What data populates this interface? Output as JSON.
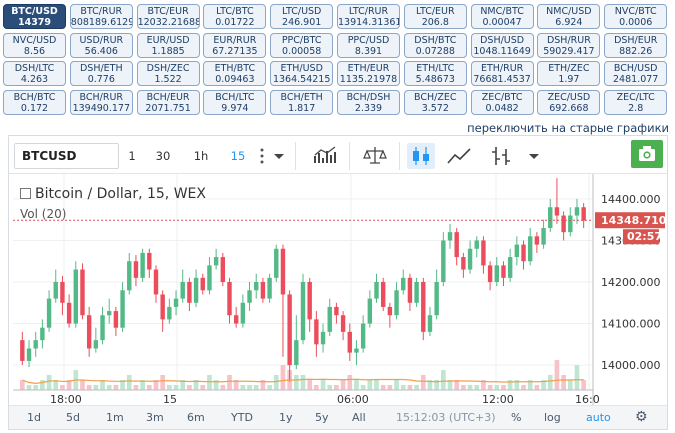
{
  "tickers": [
    {
      "pair": "BTC/USD",
      "price": "14379",
      "active": true
    },
    {
      "pair": "BTC/RUR",
      "price": "808189.6129"
    },
    {
      "pair": "BTC/EUR",
      "price": "12032.21688"
    },
    {
      "pair": "LTC/BTC",
      "price": "0.01722"
    },
    {
      "pair": "LTC/USD",
      "price": "246.901"
    },
    {
      "pair": "LTC/RUR",
      "price": "13914.31361"
    },
    {
      "pair": "LTC/EUR",
      "price": "206.8"
    },
    {
      "pair": "NMC/BTC",
      "price": "0.00047"
    },
    {
      "pair": "NMC/USD",
      "price": "6.924"
    },
    {
      "pair": "NVC/BTC",
      "price": "0.0006"
    },
    {
      "pair": "NVC/USD",
      "price": "8.56"
    },
    {
      "pair": "USD/RUR",
      "price": "56.406"
    },
    {
      "pair": "EUR/USD",
      "price": "1.1885"
    },
    {
      "pair": "EUR/RUR",
      "price": "67.27135"
    },
    {
      "pair": "PPC/BTC",
      "price": "0.00058"
    },
    {
      "pair": "PPC/USD",
      "price": "8.391"
    },
    {
      "pair": "DSH/BTC",
      "price": "0.07288"
    },
    {
      "pair": "DSH/USD",
      "price": "1048.11649"
    },
    {
      "pair": "DSH/RUR",
      "price": "59029.417"
    },
    {
      "pair": "DSH/EUR",
      "price": "882.26"
    },
    {
      "pair": "DSH/LTC",
      "price": "4.263"
    },
    {
      "pair": "DSH/ETH",
      "price": "0.776"
    },
    {
      "pair": "DSH/ZEC",
      "price": "1.522"
    },
    {
      "pair": "ETH/BTC",
      "price": "0.09463"
    },
    {
      "pair": "ETH/USD",
      "price": "1364.54215"
    },
    {
      "pair": "ETH/EUR",
      "price": "1135.21978"
    },
    {
      "pair": "ETH/LTC",
      "price": "5.48673"
    },
    {
      "pair": "ETH/RUR",
      "price": "76681.4537"
    },
    {
      "pair": "ETH/ZEC",
      "price": "1.97"
    },
    {
      "pair": "BCH/USD",
      "price": "2481.077"
    },
    {
      "pair": "BCH/BTC",
      "price": "0.172"
    },
    {
      "pair": "BCH/RUR",
      "price": "139490.177"
    },
    {
      "pair": "BCH/EUR",
      "price": "2071.751"
    },
    {
      "pair": "BCH/LTC",
      "price": "9.974"
    },
    {
      "pair": "BCH/ETH",
      "price": "1.817"
    },
    {
      "pair": "BCH/DSH",
      "price": "2.339"
    },
    {
      "pair": "BCH/ZEC",
      "price": "3.572"
    },
    {
      "pair": "ZEC/BTC",
      "price": "0.0482"
    },
    {
      "pair": "ZEC/USD",
      "price": "692.668"
    },
    {
      "pair": "ZEC/LTC",
      "price": "2.8"
    }
  ],
  "switch_link": "переключить на старые графики",
  "toolbar": {
    "symbol": "BTCUSD",
    "intervals": [
      "1",
      "30",
      "1h",
      "15"
    ],
    "active_interval": "15",
    "icons": [
      "bars-icon",
      "indicators-icon",
      "candles-icon",
      "area-icon",
      "bar-style-icon"
    ],
    "camera_icon": "camera-icon"
  },
  "legend": {
    "title": "Bitcoin / Dollar, 15, WEX",
    "volume": "Vol (20)"
  },
  "price_axis": {
    "ticks": [
      "14400.000",
      "14300.000",
      "14200.000",
      "14100.000",
      "14000.000"
    ],
    "last_price": "14348.710",
    "countdown": "02:57"
  },
  "time_axis": {
    "ticks": [
      "18:00",
      "15",
      "06:00",
      "12:00",
      "16:0"
    ]
  },
  "bottombar": {
    "ranges": [
      "1d",
      "5d",
      "1m",
      "3m",
      "6m",
      "YTD",
      "1y",
      "5y",
      "All"
    ],
    "clock": "15:12:03 (UTC+3)",
    "percent": "%",
    "log": "log",
    "auto": "auto"
  },
  "chart_data": {
    "type": "candlestick",
    "title": "Bitcoin / Dollar, 15, WEX",
    "ylim": [
      13940,
      14460
    ],
    "up_color": "#53b987",
    "down_color": "#eb4d5c",
    "candles": [
      [
        14060,
        14010,
        14080,
        14000
      ],
      [
        14010,
        14040,
        14060,
        13995
      ],
      [
        14040,
        14060,
        14080,
        14020
      ],
      [
        14060,
        14090,
        14110,
        14040
      ],
      [
        14090,
        14160,
        14180,
        14080
      ],
      [
        14160,
        14200,
        14230,
        14150
      ],
      [
        14200,
        14150,
        14215,
        14120
      ],
      [
        14150,
        14100,
        14170,
        14090
      ],
      [
        14100,
        14230,
        14250,
        14090
      ],
      [
        14230,
        14120,
        14245,
        14110
      ],
      [
        14120,
        14040,
        14140,
        14020
      ],
      [
        14040,
        14060,
        14090,
        14030
      ],
      [
        14060,
        14120,
        14140,
        14050
      ],
      [
        14120,
        14130,
        14160,
        14100
      ],
      [
        14130,
        14090,
        14140,
        14070
      ],
      [
        14090,
        14180,
        14200,
        14080
      ],
      [
        14180,
        14250,
        14270,
        14170
      ],
      [
        14250,
        14210,
        14265,
        14190
      ],
      [
        14210,
        14270,
        14280,
        14200
      ],
      [
        14270,
        14230,
        14280,
        14210
      ],
      [
        14230,
        14170,
        14240,
        14150
      ],
      [
        14170,
        14110,
        14180,
        14080
      ],
      [
        14110,
        14140,
        14160,
        14100
      ],
      [
        14140,
        14160,
        14180,
        14120
      ],
      [
        14160,
        14200,
        14230,
        14150
      ],
      [
        14200,
        14150,
        14210,
        14130
      ],
      [
        14150,
        14210,
        14230,
        14140
      ],
      [
        14210,
        14180,
        14220,
        14170
      ],
      [
        14180,
        14240,
        14260,
        14170
      ],
      [
        14240,
        14260,
        14280,
        14230
      ],
      [
        14260,
        14200,
        14270,
        14190
      ],
      [
        14200,
        14120,
        14210,
        14100
      ],
      [
        14120,
        14100,
        14140,
        14090
      ],
      [
        14100,
        14150,
        14170,
        14090
      ],
      [
        14150,
        14180,
        14200,
        14130
      ],
      [
        14180,
        14200,
        14220,
        14160
      ],
      [
        14200,
        14160,
        14210,
        14150
      ],
      [
        14160,
        14210,
        14220,
        14150
      ],
      [
        14210,
        14280,
        14290,
        14200
      ],
      [
        14280,
        14170,
        14290,
        14020
      ],
      [
        14170,
        14000,
        14180,
        13960
      ],
      [
        14000,
        14060,
        14120,
        13990
      ],
      [
        14060,
        14200,
        14220,
        14050
      ],
      [
        14200,
        14110,
        14210,
        14080
      ],
      [
        14110,
        14050,
        14130,
        14020
      ],
      [
        14050,
        14080,
        14100,
        14030
      ],
      [
        14080,
        14140,
        14160,
        14070
      ],
      [
        14140,
        14120,
        14150,
        14100
      ],
      [
        14120,
        14080,
        14130,
        14060
      ],
      [
        14080,
        14030,
        14100,
        14010
      ],
      [
        14030,
        14040,
        14060,
        14000
      ],
      [
        14040,
        14100,
        14120,
        14030
      ],
      [
        14100,
        14160,
        14180,
        14090
      ],
      [
        14160,
        14200,
        14220,
        14150
      ],
      [
        14200,
        14140,
        14210,
        14130
      ],
      [
        14140,
        14120,
        14150,
        14090
      ],
      [
        14120,
        14180,
        14200,
        14110
      ],
      [
        14180,
        14210,
        14230,
        14170
      ],
      [
        14210,
        14150,
        14220,
        14130
      ],
      [
        14150,
        14200,
        14210,
        14140
      ],
      [
        14200,
        14080,
        14210,
        14060
      ],
      [
        14080,
        14120,
        14140,
        14070
      ],
      [
        14120,
        14200,
        14230,
        14110
      ],
      [
        14200,
        14300,
        14320,
        14190
      ],
      [
        14300,
        14320,
        14340,
        14280
      ],
      [
        14320,
        14260,
        14330,
        14240
      ],
      [
        14260,
        14230,
        14270,
        14210
      ],
      [
        14230,
        14280,
        14300,
        14220
      ],
      [
        14280,
        14300,
        14310,
        14260
      ],
      [
        14300,
        14240,
        14310,
        14220
      ],
      [
        14240,
        14200,
        14250,
        14180
      ],
      [
        14200,
        14240,
        14260,
        14190
      ],
      [
        14240,
        14210,
        14250,
        14190
      ],
      [
        14210,
        14260,
        14280,
        14200
      ],
      [
        14260,
        14290,
        14310,
        14240
      ],
      [
        14290,
        14250,
        14300,
        14230
      ],
      [
        14250,
        14310,
        14330,
        14240
      ],
      [
        14310,
        14290,
        14320,
        14270
      ],
      [
        14290,
        14330,
        14350,
        14280
      ],
      [
        14330,
        14380,
        14400,
        14320
      ],
      [
        14380,
        14360,
        14450,
        14340
      ],
      [
        14360,
        14320,
        14370,
        14300
      ],
      [
        14320,
        14360,
        14380,
        14310
      ],
      [
        14360,
        14380,
        14400,
        14340
      ],
      [
        14380,
        14348,
        14390,
        14330
      ]
    ],
    "volumes": [
      2,
      1,
      1,
      2,
      3,
      2,
      1,
      2,
      4,
      2,
      1,
      1,
      2,
      1,
      1,
      2,
      3,
      1,
      2,
      1,
      2,
      3,
      1,
      1,
      2,
      1,
      2,
      1,
      3,
      2,
      1,
      3,
      2,
      1,
      1,
      1,
      2,
      1,
      3,
      5,
      4,
      3,
      3,
      2,
      1,
      2,
      1,
      1,
      2,
      3,
      2,
      1,
      2,
      2,
      1,
      1,
      2,
      1,
      1,
      1,
      3,
      2,
      2,
      4,
      2,
      2,
      1,
      1,
      1,
      2,
      1,
      1,
      1,
      2,
      2,
      1,
      2,
      1,
      2,
      3,
      6,
      3,
      2,
      5,
      2
    ]
  }
}
